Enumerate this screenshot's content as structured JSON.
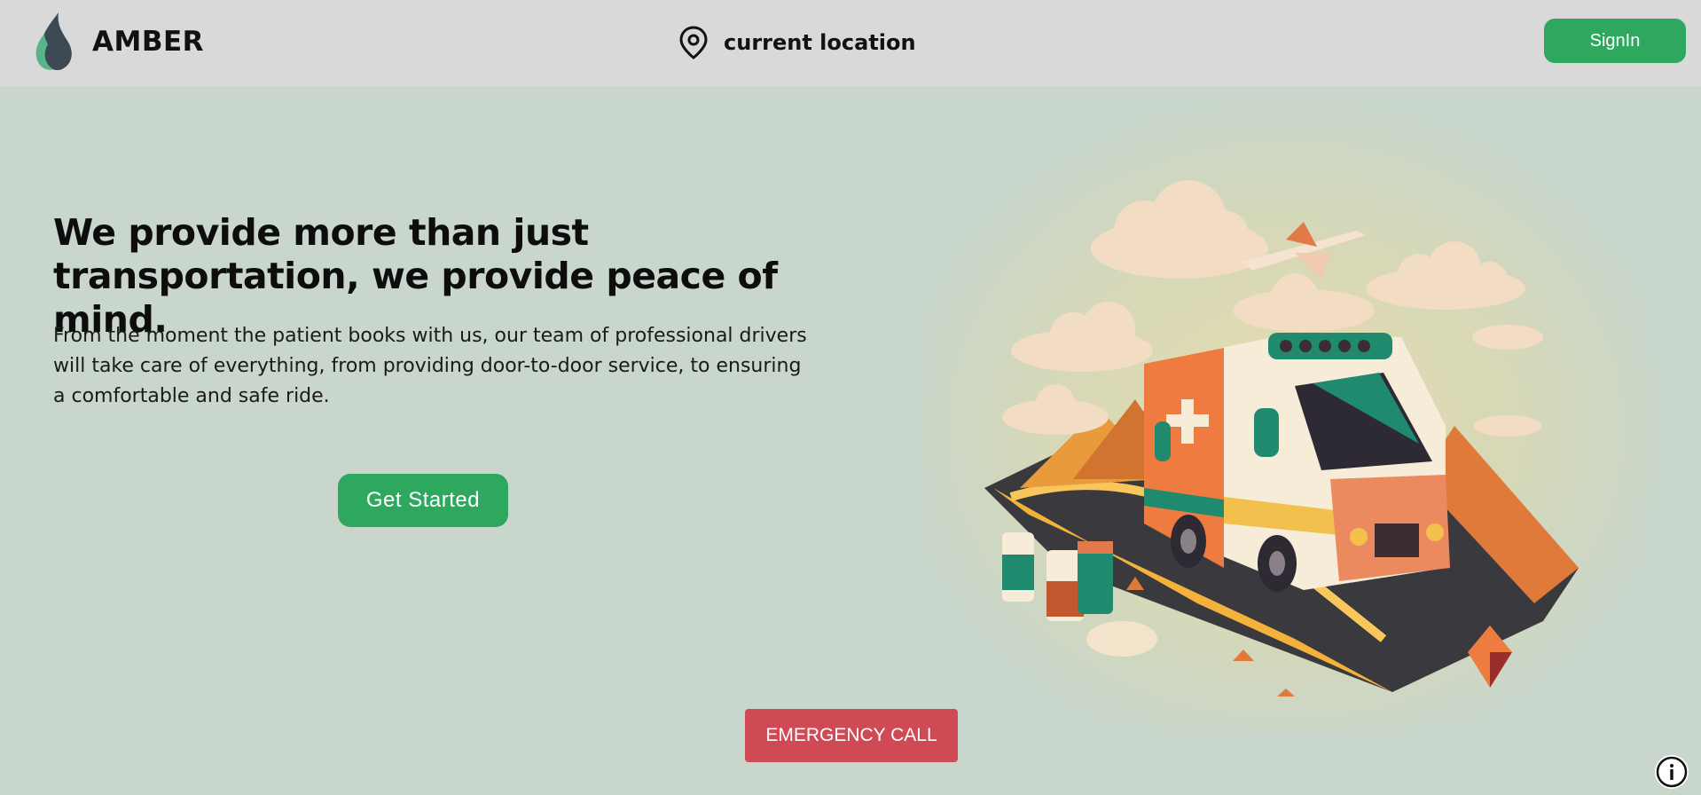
{
  "navbar": {
    "brand": {
      "name": "AMBER",
      "icon": "flame-logo-icon"
    },
    "location": {
      "icon": "map-pin-icon",
      "label": "current location"
    },
    "signin_label": "SignIn"
  },
  "hero": {
    "title": "We provide more than just transportation, we provide peace of mind.",
    "description": "From the moment the patient books with us, our team of professional drivers will take care of everything, from providing door-to-door service, to ensuring a comfortable and safe ride.",
    "cta_label": "Get Started",
    "illustration": "ambulance-illustration"
  },
  "emergency_label": "EMERGENCY CALL",
  "info_icon": "info-icon",
  "colors": {
    "accent": "#2ea85f",
    "emergency": "#d04a55",
    "navbar_bg": "#d9d9d9",
    "page_bg": "#c8d6cc"
  }
}
